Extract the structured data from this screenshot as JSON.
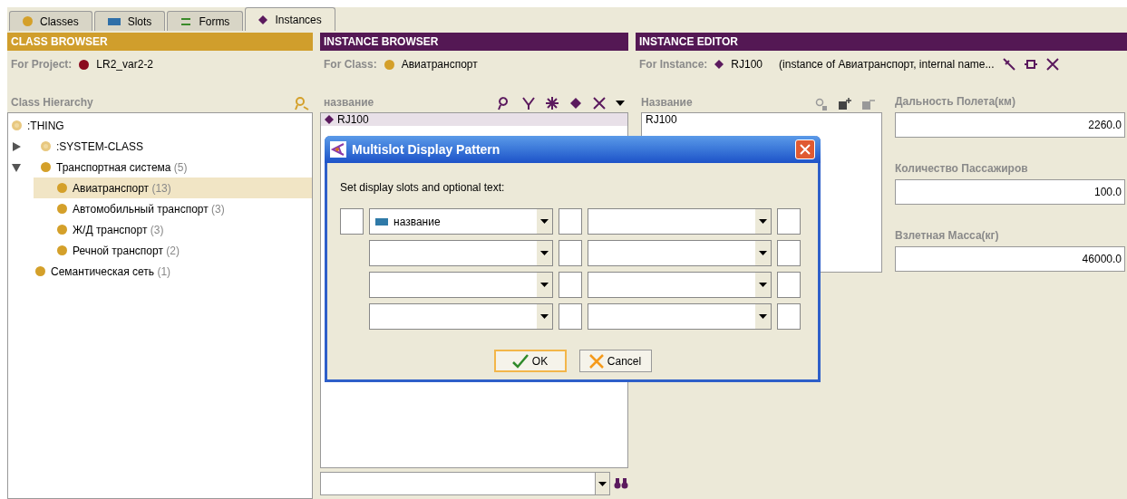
{
  "tabs": [
    {
      "label": "Classes",
      "kind": "class",
      "selected": false
    },
    {
      "label": "Slots",
      "kind": "slot",
      "selected": false
    },
    {
      "label": "Forms",
      "kind": "form",
      "selected": false
    },
    {
      "label": "Instances",
      "kind": "instance",
      "selected": true
    }
  ],
  "class_browser": {
    "title": "CLASS BROWSER",
    "project_label": "For Project:",
    "project": "LR2_var2-2",
    "hierarchy_label": "Class Hierarchy",
    "tree": [
      {
        "name": ":THING",
        "kind": "system",
        "children": [
          {
            "name": ":SYSTEM-CLASS",
            "kind": "system",
            "expanded": false
          },
          {
            "name": "Транспортная система",
            "count": "(5)",
            "kind": "class",
            "expanded": true,
            "children": [
              {
                "name": "Авиатранспорт",
                "count": "(13)",
                "kind": "class",
                "selected": true
              },
              {
                "name": "Автомобильный транспорт",
                "count": "(3)",
                "kind": "class",
                "selected": false
              },
              {
                "name": "Ж/Д транспорт",
                "count": "(3)",
                "kind": "class",
                "selected": false
              },
              {
                "name": "Речной транспорт",
                "count": "(2)",
                "kind": "class",
                "selected": false
              }
            ]
          },
          {
            "name": "Семантическая сеть",
            "count": "(1)",
            "kind": "class",
            "selected": false
          }
        ]
      }
    ]
  },
  "instance_browser": {
    "title": "INSTANCE BROWSER",
    "class_label": "For Class:",
    "class": "Авиатранспорт",
    "column": "название",
    "instances": [
      {
        "name": "RJ100",
        "selected": true
      }
    ]
  },
  "instance_editor": {
    "title": "INSTANCE EDITOR",
    "instance_label": "For Instance:",
    "instance": "RJ100",
    "description": "(instance of Авиатранспорт, internal name...",
    "name_label": "Название",
    "name_values": [
      "RJ100"
    ],
    "fields": [
      {
        "label": "Дальность Полета(км)",
        "value": "2260.0"
      },
      {
        "label": "Количество Пассажиров",
        "value": "100.0"
      },
      {
        "label": "Взлетная Масса(кг)",
        "value": "46000.0"
      }
    ]
  },
  "dialog": {
    "title": "Multislot Display Pattern",
    "prompt": "Set display slots and optional text:",
    "rows": [
      {
        "slot_a": "название",
        "slot_b": ""
      },
      {
        "slot_a": "",
        "slot_b": ""
      },
      {
        "slot_a": "",
        "slot_b": ""
      },
      {
        "slot_a": "",
        "slot_b": ""
      }
    ],
    "ok": "OK",
    "cancel": "Cancel"
  }
}
